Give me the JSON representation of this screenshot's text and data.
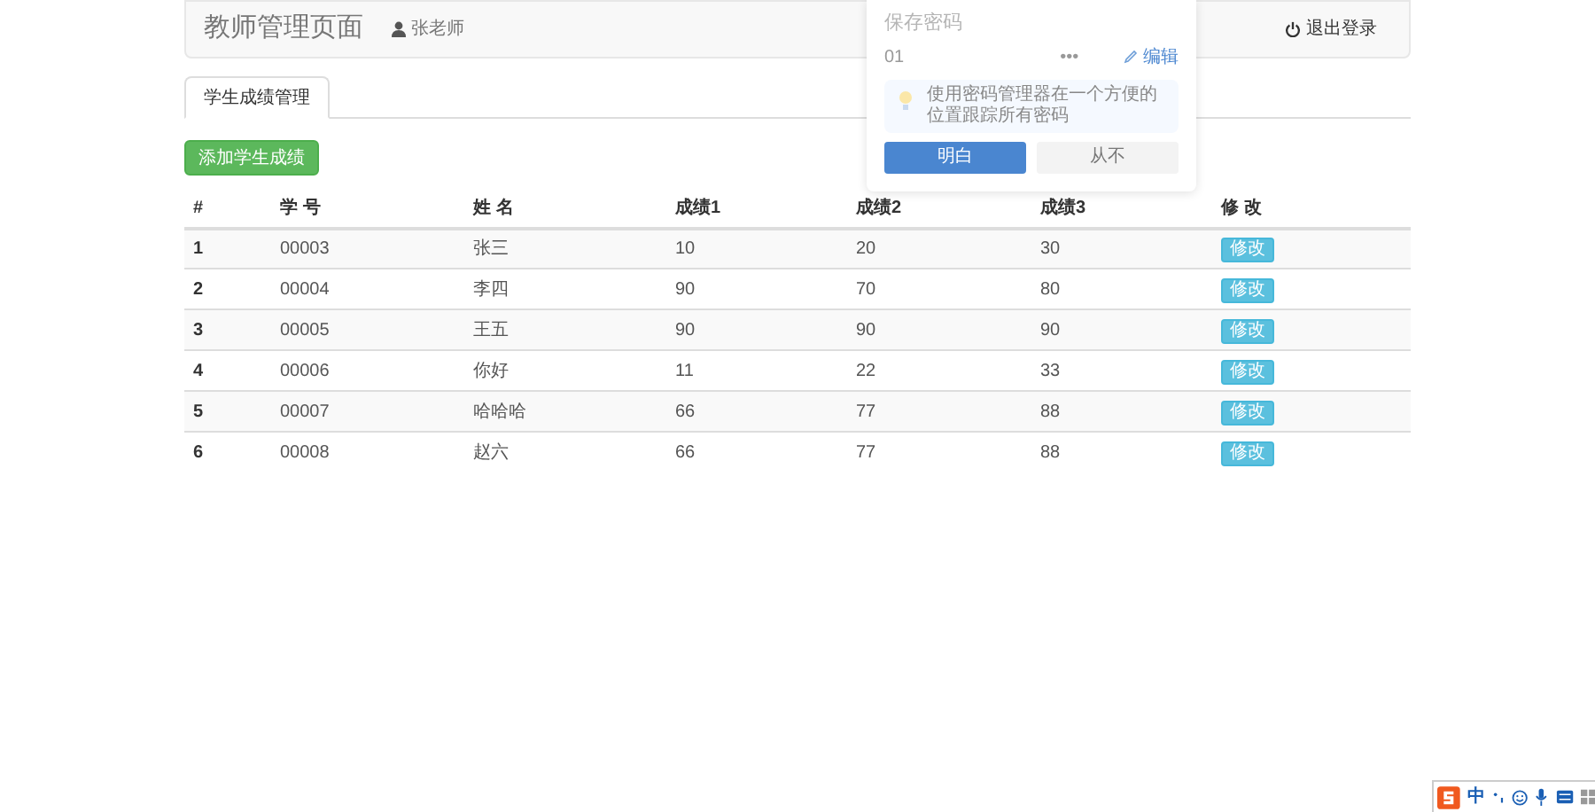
{
  "navbar": {
    "brand": "教师管理页面",
    "user": "张老师",
    "logout": "退出登录"
  },
  "tabs": [
    {
      "label": "学生成绩管理",
      "selected": true
    }
  ],
  "add_button": "添加学生成绩",
  "table": {
    "columns": [
      "#",
      "学 号",
      "姓 名",
      "成绩1",
      "成绩2",
      "成绩3",
      "修 改"
    ],
    "rows": [
      {
        "cells": [
          "1",
          "00003",
          "张三",
          "10",
          "20",
          "30"
        ],
        "action": "修改"
      },
      {
        "cells": [
          "2",
          "00004",
          "李四",
          "90",
          "70",
          "80"
        ],
        "action": "修改"
      },
      {
        "cells": [
          "3",
          "00005",
          "王五",
          "90",
          "90",
          "90"
        ],
        "action": "修改"
      },
      {
        "cells": [
          "4",
          "00006",
          "你好",
          "11",
          "22",
          "33"
        ],
        "action": "修改"
      },
      {
        "cells": [
          "5",
          "00007",
          "哈哈哈",
          "66",
          "77",
          "88"
        ],
        "action": "修改"
      },
      {
        "cells": [
          "6",
          "00008",
          "赵六",
          "66",
          "77",
          "88"
        ],
        "action": "修改"
      }
    ]
  },
  "password_popup": {
    "title": "保存密码",
    "username": "01",
    "password": "•••",
    "edit": "编辑",
    "tip": "使用密码管理器在一个方便的位置跟踪所有密码",
    "confirm": "明白",
    "never": "从不"
  },
  "ime_bar": {
    "mode": "中"
  }
}
